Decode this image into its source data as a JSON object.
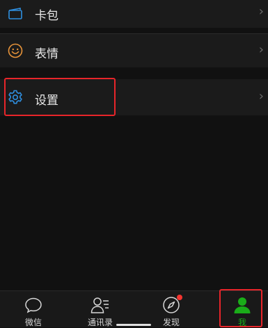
{
  "menu": {
    "items": [
      {
        "label": "卡包",
        "icon": "wallet-card-icon"
      },
      {
        "label": "表情",
        "icon": "smiley-icon"
      },
      {
        "label": "设置",
        "icon": "gear-icon"
      }
    ],
    "chevron": "›"
  },
  "tabbar": {
    "tabs": [
      {
        "label": "微信",
        "icon": "chat-bubble-icon",
        "active": false
      },
      {
        "label": "通讯录",
        "icon": "contacts-icon",
        "active": false
      },
      {
        "label": "发现",
        "icon": "compass-icon",
        "active": false,
        "badge_dot": true
      },
      {
        "label": "我",
        "icon": "person-icon",
        "active": true
      }
    ]
  },
  "colors": {
    "accent_green": "#1aad19",
    "icon_blue": "#2f8fe0",
    "icon_orange": "#e8943a",
    "highlight_red": "#e8252a",
    "badge_red": "#f43530"
  }
}
